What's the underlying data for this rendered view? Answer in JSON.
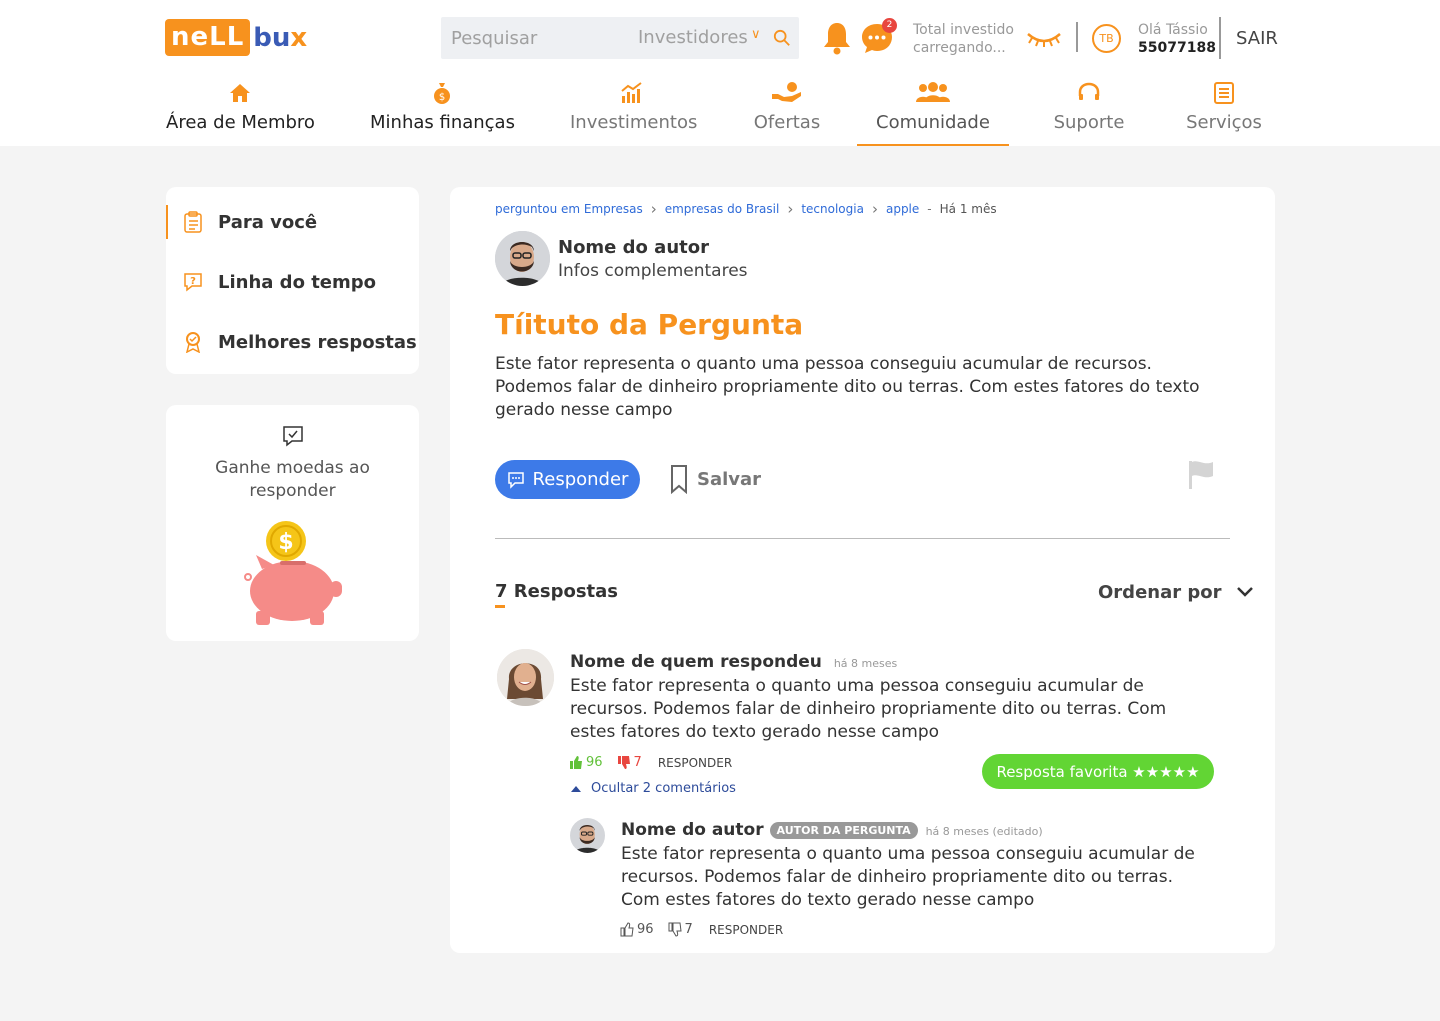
{
  "header": {
    "logo_part1": "neLL",
    "logo_part2": "bu",
    "logo_part3": "x",
    "search_placeholder": "Pesquisar",
    "search_scope": "Investidores",
    "notifications_count": "2",
    "total_label": "Total investido",
    "total_value": "carregando...",
    "avatar_initials": "TB",
    "greeting": "Olá Tássio",
    "user_id": "55077188",
    "logout": "SAIR"
  },
  "nav": [
    {
      "label": "Área de Membro",
      "icon": "home-icon"
    },
    {
      "label": "Minhas finanças",
      "icon": "money-bag-icon"
    },
    {
      "label": "Investimentos",
      "icon": "chart-icon"
    },
    {
      "label": "Ofertas",
      "icon": "hand-coin-icon"
    },
    {
      "label": "Comunidade",
      "icon": "people-icon"
    },
    {
      "label": "Suporte",
      "icon": "headset-icon"
    },
    {
      "label": "Serviços",
      "icon": "document-icon"
    }
  ],
  "sidebar": {
    "items": [
      {
        "label": "Para você",
        "icon": "clipboard-icon"
      },
      {
        "label": "Linha do tempo",
        "icon": "question-bubble-icon"
      },
      {
        "label": "Melhores respostas",
        "icon": "award-icon"
      }
    ],
    "promo_text": "Ganhe moedas ao responder"
  },
  "question": {
    "breadcrumb": [
      "perguntou em Empresas",
      "empresas do Brasil",
      "tecnologia",
      "apple"
    ],
    "time": "Há 1 mês",
    "author_name": "Nome do autor",
    "author_info": "Infos complementares",
    "title": "Tíituto da Pergunta",
    "body": "Este fator representa o quanto uma pessoa conseguiu acumular de recursos. Podemos falar de dinheiro propriamente dito ou terras. Com estes fatores do texto gerado nesse campo",
    "reply_button": "Responder",
    "save_button": "Salvar"
  },
  "answers": {
    "count_label": "7 Respostas",
    "order_label": "Ordenar por",
    "items": [
      {
        "name": "Nome de quem respondeu",
        "time": "há 8 meses",
        "body": "Este fator representa o quanto uma pessoa conseguiu acumular de recursos. Podemos falar de dinheiro propriamente dito ou terras. Com estes fatores do texto gerado nesse campo",
        "likes": "96",
        "dislikes": "7",
        "reply": "RESPONDER",
        "hide_comments": "Ocultar 2 comentários",
        "favorite": "Resposta favorita ★★★★★"
      }
    ],
    "comment": {
      "name": "Nome do autor",
      "badge": "AUTOR DA PERGUNTA",
      "time": "há 8 meses (editado)",
      "body": "Este fator representa o quanto uma pessoa conseguiu acumular de recursos. Podemos falar de dinheiro propriamente dito ou terras. Com estes fatores do texto gerado nesse campo",
      "likes": "96",
      "dislikes": "7",
      "reply": "RESPONDER"
    }
  },
  "colors": {
    "accent": "#f7921e",
    "primary": "#3d7ae8",
    "success": "#62d534",
    "link": "#2f6bd8"
  }
}
